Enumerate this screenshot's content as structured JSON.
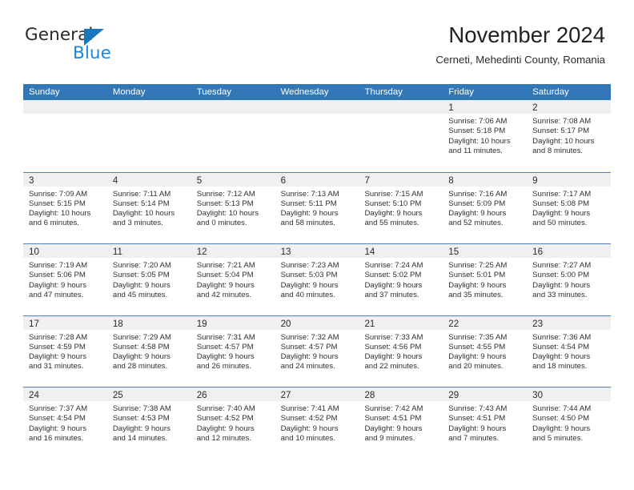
{
  "brand": {
    "name_part1": "General",
    "name_part2": "Blue"
  },
  "header": {
    "title": "November 2024",
    "subtitle": "Cerneti, Mehedinti County, Romania"
  },
  "calendar": {
    "weekdays": [
      "Sunday",
      "Monday",
      "Tuesday",
      "Wednesday",
      "Thursday",
      "Friday",
      "Saturday"
    ],
    "accent_color": "#3277b8",
    "band_color": "#f0f0f0",
    "weeks": [
      [
        {
          "day": "",
          "sunrise": "",
          "sunset": "",
          "daylight1": "",
          "daylight2": ""
        },
        {
          "day": "",
          "sunrise": "",
          "sunset": "",
          "daylight1": "",
          "daylight2": ""
        },
        {
          "day": "",
          "sunrise": "",
          "sunset": "",
          "daylight1": "",
          "daylight2": ""
        },
        {
          "day": "",
          "sunrise": "",
          "sunset": "",
          "daylight1": "",
          "daylight2": ""
        },
        {
          "day": "",
          "sunrise": "",
          "sunset": "",
          "daylight1": "",
          "daylight2": ""
        },
        {
          "day": "1",
          "sunrise": "Sunrise: 7:06 AM",
          "sunset": "Sunset: 5:18 PM",
          "daylight1": "Daylight: 10 hours",
          "daylight2": "and 11 minutes."
        },
        {
          "day": "2",
          "sunrise": "Sunrise: 7:08 AM",
          "sunset": "Sunset: 5:17 PM",
          "daylight1": "Daylight: 10 hours",
          "daylight2": "and 8 minutes."
        }
      ],
      [
        {
          "day": "3",
          "sunrise": "Sunrise: 7:09 AM",
          "sunset": "Sunset: 5:15 PM",
          "daylight1": "Daylight: 10 hours",
          "daylight2": "and 6 minutes."
        },
        {
          "day": "4",
          "sunrise": "Sunrise: 7:11 AM",
          "sunset": "Sunset: 5:14 PM",
          "daylight1": "Daylight: 10 hours",
          "daylight2": "and 3 minutes."
        },
        {
          "day": "5",
          "sunrise": "Sunrise: 7:12 AM",
          "sunset": "Sunset: 5:13 PM",
          "daylight1": "Daylight: 10 hours",
          "daylight2": "and 0 minutes."
        },
        {
          "day": "6",
          "sunrise": "Sunrise: 7:13 AM",
          "sunset": "Sunset: 5:11 PM",
          "daylight1": "Daylight: 9 hours",
          "daylight2": "and 58 minutes."
        },
        {
          "day": "7",
          "sunrise": "Sunrise: 7:15 AM",
          "sunset": "Sunset: 5:10 PM",
          "daylight1": "Daylight: 9 hours",
          "daylight2": "and 55 minutes."
        },
        {
          "day": "8",
          "sunrise": "Sunrise: 7:16 AM",
          "sunset": "Sunset: 5:09 PM",
          "daylight1": "Daylight: 9 hours",
          "daylight2": "and 52 minutes."
        },
        {
          "day": "9",
          "sunrise": "Sunrise: 7:17 AM",
          "sunset": "Sunset: 5:08 PM",
          "daylight1": "Daylight: 9 hours",
          "daylight2": "and 50 minutes."
        }
      ],
      [
        {
          "day": "10",
          "sunrise": "Sunrise: 7:19 AM",
          "sunset": "Sunset: 5:06 PM",
          "daylight1": "Daylight: 9 hours",
          "daylight2": "and 47 minutes."
        },
        {
          "day": "11",
          "sunrise": "Sunrise: 7:20 AM",
          "sunset": "Sunset: 5:05 PM",
          "daylight1": "Daylight: 9 hours",
          "daylight2": "and 45 minutes."
        },
        {
          "day": "12",
          "sunrise": "Sunrise: 7:21 AM",
          "sunset": "Sunset: 5:04 PM",
          "daylight1": "Daylight: 9 hours",
          "daylight2": "and 42 minutes."
        },
        {
          "day": "13",
          "sunrise": "Sunrise: 7:23 AM",
          "sunset": "Sunset: 5:03 PM",
          "daylight1": "Daylight: 9 hours",
          "daylight2": "and 40 minutes."
        },
        {
          "day": "14",
          "sunrise": "Sunrise: 7:24 AM",
          "sunset": "Sunset: 5:02 PM",
          "daylight1": "Daylight: 9 hours",
          "daylight2": "and 37 minutes."
        },
        {
          "day": "15",
          "sunrise": "Sunrise: 7:25 AM",
          "sunset": "Sunset: 5:01 PM",
          "daylight1": "Daylight: 9 hours",
          "daylight2": "and 35 minutes."
        },
        {
          "day": "16",
          "sunrise": "Sunrise: 7:27 AM",
          "sunset": "Sunset: 5:00 PM",
          "daylight1": "Daylight: 9 hours",
          "daylight2": "and 33 minutes."
        }
      ],
      [
        {
          "day": "17",
          "sunrise": "Sunrise: 7:28 AM",
          "sunset": "Sunset: 4:59 PM",
          "daylight1": "Daylight: 9 hours",
          "daylight2": "and 31 minutes."
        },
        {
          "day": "18",
          "sunrise": "Sunrise: 7:29 AM",
          "sunset": "Sunset: 4:58 PM",
          "daylight1": "Daylight: 9 hours",
          "daylight2": "and 28 minutes."
        },
        {
          "day": "19",
          "sunrise": "Sunrise: 7:31 AM",
          "sunset": "Sunset: 4:57 PM",
          "daylight1": "Daylight: 9 hours",
          "daylight2": "and 26 minutes."
        },
        {
          "day": "20",
          "sunrise": "Sunrise: 7:32 AM",
          "sunset": "Sunset: 4:57 PM",
          "daylight1": "Daylight: 9 hours",
          "daylight2": "and 24 minutes."
        },
        {
          "day": "21",
          "sunrise": "Sunrise: 7:33 AM",
          "sunset": "Sunset: 4:56 PM",
          "daylight1": "Daylight: 9 hours",
          "daylight2": "and 22 minutes."
        },
        {
          "day": "22",
          "sunrise": "Sunrise: 7:35 AM",
          "sunset": "Sunset: 4:55 PM",
          "daylight1": "Daylight: 9 hours",
          "daylight2": "and 20 minutes."
        },
        {
          "day": "23",
          "sunrise": "Sunrise: 7:36 AM",
          "sunset": "Sunset: 4:54 PM",
          "daylight1": "Daylight: 9 hours",
          "daylight2": "and 18 minutes."
        }
      ],
      [
        {
          "day": "24",
          "sunrise": "Sunrise: 7:37 AM",
          "sunset": "Sunset: 4:54 PM",
          "daylight1": "Daylight: 9 hours",
          "daylight2": "and 16 minutes."
        },
        {
          "day": "25",
          "sunrise": "Sunrise: 7:38 AM",
          "sunset": "Sunset: 4:53 PM",
          "daylight1": "Daylight: 9 hours",
          "daylight2": "and 14 minutes."
        },
        {
          "day": "26",
          "sunrise": "Sunrise: 7:40 AM",
          "sunset": "Sunset: 4:52 PM",
          "daylight1": "Daylight: 9 hours",
          "daylight2": "and 12 minutes."
        },
        {
          "day": "27",
          "sunrise": "Sunrise: 7:41 AM",
          "sunset": "Sunset: 4:52 PM",
          "daylight1": "Daylight: 9 hours",
          "daylight2": "and 10 minutes."
        },
        {
          "day": "28",
          "sunrise": "Sunrise: 7:42 AM",
          "sunset": "Sunset: 4:51 PM",
          "daylight1": "Daylight: 9 hours",
          "daylight2": "and 9 minutes."
        },
        {
          "day": "29",
          "sunrise": "Sunrise: 7:43 AM",
          "sunset": "Sunset: 4:51 PM",
          "daylight1": "Daylight: 9 hours",
          "daylight2": "and 7 minutes."
        },
        {
          "day": "30",
          "sunrise": "Sunrise: 7:44 AM",
          "sunset": "Sunset: 4:50 PM",
          "daylight1": "Daylight: 9 hours",
          "daylight2": "and 5 minutes."
        }
      ]
    ]
  }
}
